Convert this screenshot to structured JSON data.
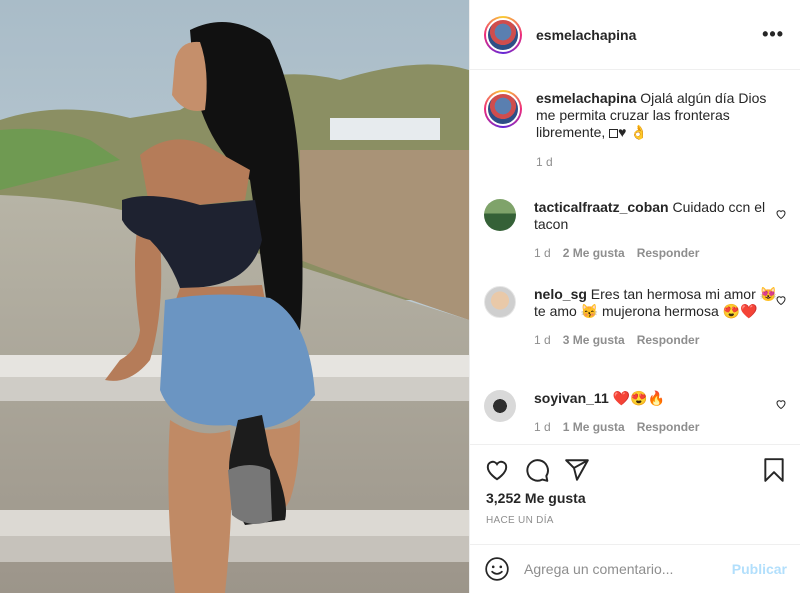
{
  "post": {
    "username": "esmelachapina",
    "more_label": "•••"
  },
  "caption": {
    "username": "esmelachapina",
    "text": "Ojalá algún día Dios me permita cruzar las fronteras libremente,",
    "emoji": "♥ 👌",
    "age": "1 d"
  },
  "comments": [
    {
      "username": "tacticalfraatz_coban",
      "text": "Cuidado ccn el tacon",
      "age": "1 d",
      "likes": "2 Me gusta",
      "reply": "Responder"
    },
    {
      "username": "nelo_sg",
      "text": "Eres tan hermosa mi amor 😻 te amo 😽 mujerona hermosa 😍❤️",
      "age": "1 d",
      "likes": "3 Me gusta",
      "reply": "Responder"
    },
    {
      "username": "soyivan_11",
      "text": "❤️😍🔥",
      "age": "1 d",
      "likes": "1 Me gusta",
      "reply": "Responder"
    }
  ],
  "actions": {
    "likes": "3,252 Me gusta",
    "timestamp": "HACE UN DÍA"
  },
  "add_comment": {
    "placeholder": "Agrega un comentario...",
    "publish": "Publicar"
  },
  "colors": {
    "text": "#262626",
    "secondary": "#8e8e8e",
    "publish_disabled": "#b2dffc",
    "border": "#efefef"
  },
  "icons": [
    "heart-icon",
    "comment-icon",
    "share-icon",
    "bookmark-icon",
    "emoji-icon",
    "more-icon"
  ]
}
